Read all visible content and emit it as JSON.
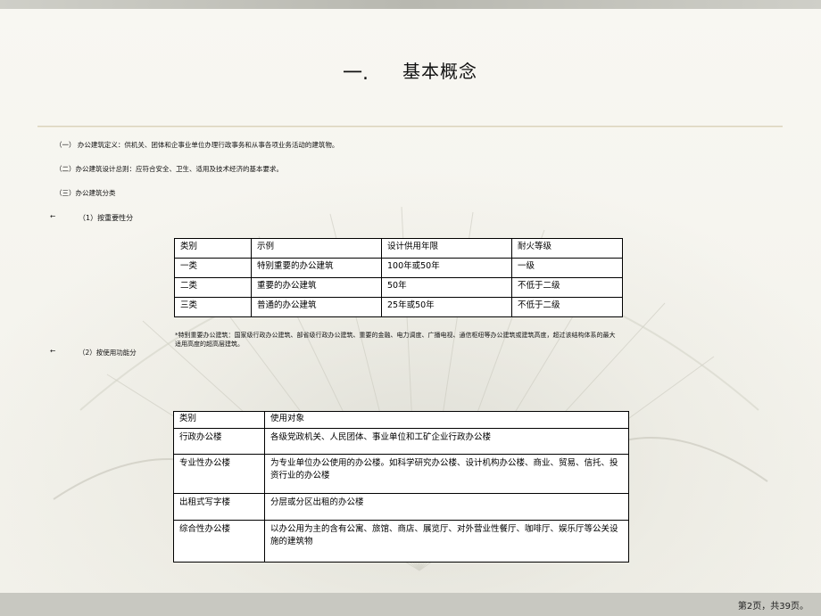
{
  "title": {
    "number": "一.",
    "text": "基本概念"
  },
  "lines": [
    "（一）  办公建筑定义：供机关、团体和企事业单位办理行政事务和从事各项业务活动的建筑物。",
    "（二）办公建筑设计总则：应符合安全、卫生、适用及技术经济的基本要求。",
    "（三）办公建筑分类"
  ],
  "sub1": {
    "arrow": "←",
    "label": "（1）按重要性分"
  },
  "sub2": {
    "arrow": "←",
    "label": "（2）按使用功能分"
  },
  "table1": {
    "headers": [
      "类别",
      "示例",
      "设计供用年限",
      "耐火等级"
    ],
    "rows": [
      [
        "一类",
        "特别重要的办公建筑",
        "100年或50年",
        "一级"
      ],
      [
        "二类",
        "重要的办公建筑",
        "50年",
        "不低于二级"
      ],
      [
        "三类",
        "普通的办公建筑",
        "25年或50年",
        "不低于二级"
      ]
    ]
  },
  "note": "*特别重要办公建筑：国家级行政办公建筑、部省级行政办公建筑、重要的金融、电力调度、广播电视、通信枢纽等办公建筑或建筑高度，超过该结构体系的最大适用高度的超高层建筑。",
  "table2": {
    "headers": [
      "类别",
      "使用对象"
    ],
    "rows": [
      [
        "行政办公楼",
        "各级党政机关、人民团体、事业单位和工矿企业行政办公楼"
      ],
      [
        "专业性办公楼",
        "为专业单位办公使用的办公楼。如科学研究办公楼、设计机构办公楼、商业、贸易、信托、投资行业的办公楼"
      ],
      [
        "出租式写字楼",
        "分层或分区出租的办公楼"
      ],
      [
        "综合性办公楼",
        "以办公用为主的含有公寓、旅馆、商店、展览厅、对外营业性餐厅、咖啡厅、娱乐厅等公关设施的建筑物"
      ]
    ]
  },
  "footer": "第2页，共39页。"
}
